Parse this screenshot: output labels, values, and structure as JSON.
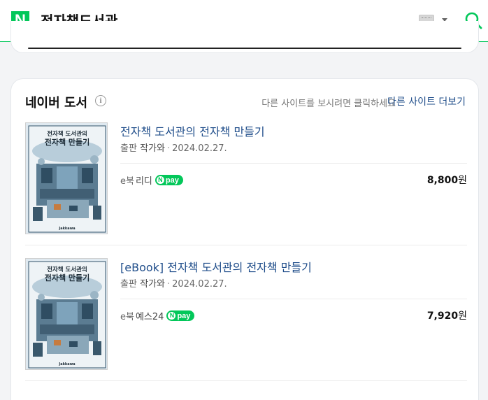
{
  "header": {
    "logo": "N",
    "query": "전자책도서관"
  },
  "section": {
    "title": "네이버 도서",
    "guide_text": "다른 사이트를 보시려면 클릭하세요",
    "more_link": "다른 사이트 더보기"
  },
  "books": [
    {
      "title": "전자책 도서관의 전자책 만들기",
      "pub_label": "출판",
      "publisher": "작가와",
      "date": "2024.02.27.",
      "format": "e북",
      "store": "리디",
      "npay_label": "pay",
      "npay_n": "N",
      "price": "8,800",
      "currency": "원",
      "cover_title": "전자책 도서관의\n전자책 만들기",
      "cover_publisher": "Jakkawa"
    },
    {
      "title": "[eBook] 전자책 도서관의 전자책 만들기",
      "pub_label": "출판",
      "publisher": "작가와",
      "date": "2024.02.27.",
      "format": "e북",
      "store": "예스24",
      "npay_label": "pay",
      "npay_n": "N",
      "price": "7,920",
      "currency": "원",
      "cover_title": "전자책 도서관의\n전자책 만들기",
      "cover_publisher": "Jakkawa"
    }
  ],
  "colors": {
    "brand_green": "#03c75a",
    "link_blue": "#1f4d8a"
  },
  "icons": {
    "info": "info-circle-icon",
    "keyboard": "keyboard-icon",
    "search": "search-icon"
  }
}
